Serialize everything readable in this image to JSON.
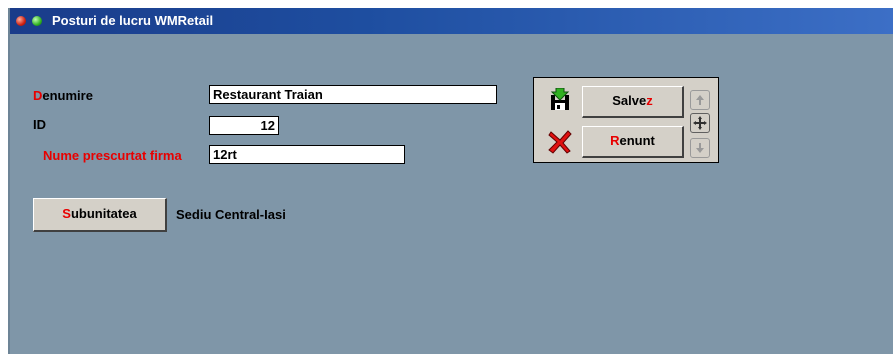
{
  "window": {
    "title": "Posturi de lucru WMRetail"
  },
  "form": {
    "denumire": {
      "label_hot": "D",
      "label_rest": "enumire",
      "value": "Restaurant Traian"
    },
    "id": {
      "label": "ID",
      "value": "12"
    },
    "nume_prescurtat": {
      "label": "Nume prescurtat firma",
      "value": "12rt"
    }
  },
  "subunitate": {
    "btn_hot": "S",
    "btn_rest": "ubunitatea",
    "value": "Sediu Central-Iasi"
  },
  "actions": {
    "save_pre": "Salve",
    "save_hot": "z",
    "cancel_hot": "R",
    "cancel_rest": "enunt"
  },
  "icons": {
    "save": "save-disk-icon",
    "cancel": "red-x-icon",
    "up": "arrow-up-icon",
    "down": "arrow-down-icon",
    "move": "move-cross-icon"
  }
}
